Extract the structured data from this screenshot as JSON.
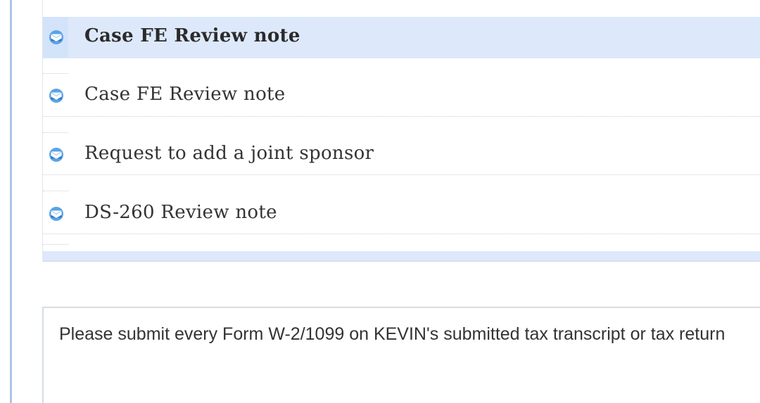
{
  "messages": [
    {
      "subject": "Case FE Review note",
      "selected": true,
      "icon": "envelope-icon"
    },
    {
      "subject": "Case FE Review note",
      "selected": false,
      "icon": "envelope-icon"
    },
    {
      "subject": "Request to add a joint sponsor",
      "selected": false,
      "icon": "envelope-icon"
    },
    {
      "subject": "DS-260 Review note",
      "selected": false,
      "icon": "envelope-icon"
    }
  ],
  "message_body": {
    "text": "Please submit every Form W-2/1099 on KEVIN's submitted tax transcript or tax return"
  },
  "colors": {
    "selected_row_bg": "#dde9fb",
    "icon_blue": "#4a90d9",
    "accent_rule": "#a9c6e6"
  }
}
